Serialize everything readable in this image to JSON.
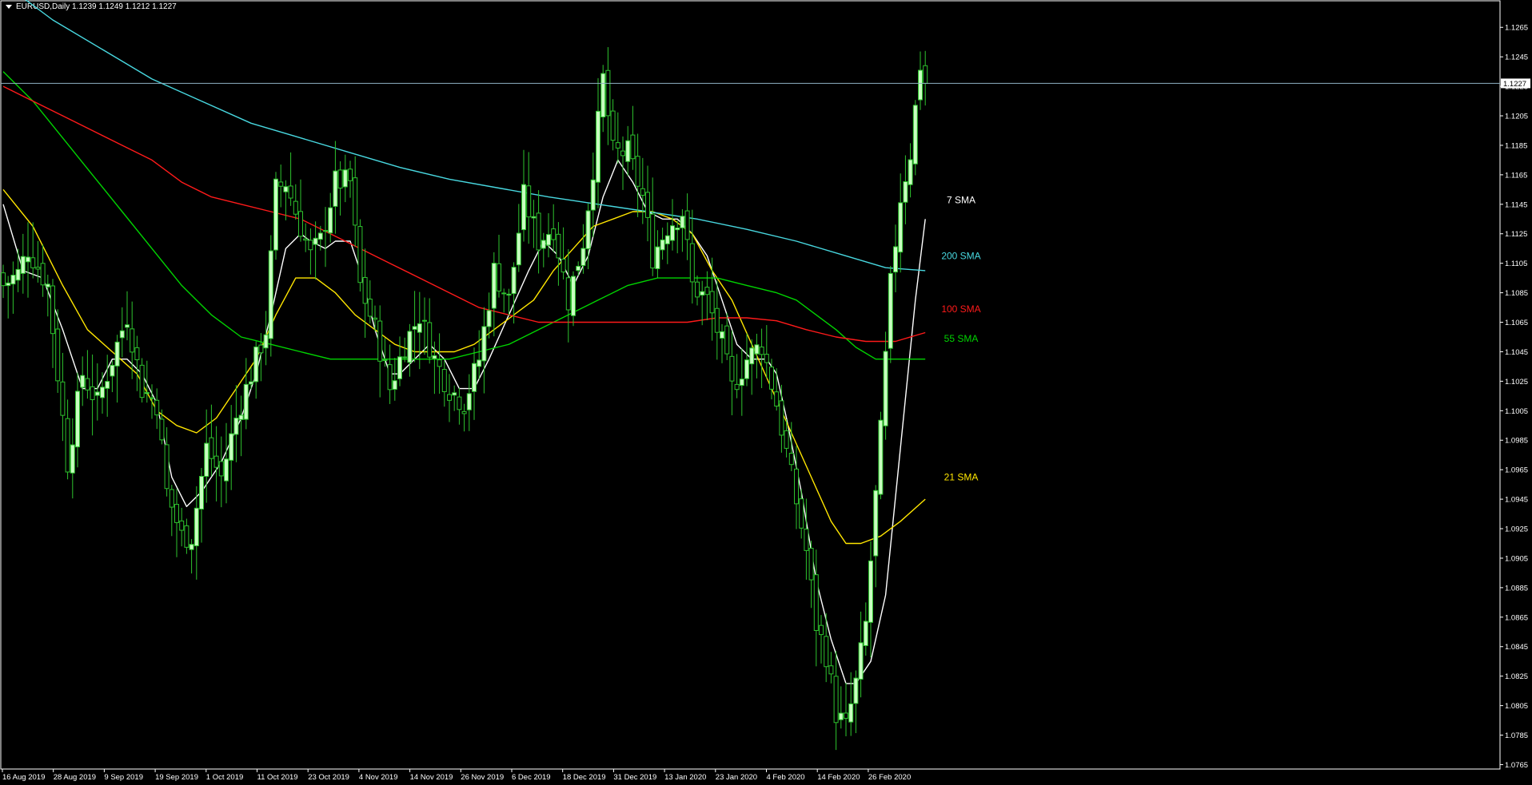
{
  "header": {
    "symbol_line": "EURUSD,Daily  1.1239 1.1249 1.1212 1.1227"
  },
  "colors": {
    "background": "#000000",
    "frame": "#ffffff",
    "candle_bull_body": "#c8ffc0",
    "candle_wick": "#2ec32e",
    "candle_bear_body": "#000000",
    "sma7": "#ffffff",
    "sma21": "#ffe600",
    "sma55": "#00d400",
    "sma100": "#ff1a1a",
    "sma200": "#48d8e0",
    "bid_line": "#8fb3c4",
    "axis_text": "#ffffff"
  },
  "chart_data": {
    "type": "candlestick",
    "symbol": "EURUSD",
    "timeframe": "Daily",
    "last_ohlc": {
      "open": 1.1239,
      "high": 1.1249,
      "low": 1.1212,
      "close": 1.1227
    },
    "current_price_label": "1.1227",
    "ylim": [
      1.0762,
      1.1283
    ],
    "y_ticks": [
      "1.1265",
      "1.1245",
      "1.1225",
      "1.1205",
      "1.1185",
      "1.1165",
      "1.1145",
      "1.1125",
      "1.1105",
      "1.1085",
      "1.1065",
      "1.1045",
      "1.1025",
      "1.1005",
      "1.0985",
      "1.0965",
      "1.0945",
      "1.0925",
      "1.0905",
      "1.0885",
      "1.0865",
      "1.0845",
      "1.0825",
      "1.0805",
      "1.0785",
      "1.0765"
    ],
    "x_ticks": [
      "16 Aug 2019",
      "28 Aug 2019",
      "9 Sep 2019",
      "19 Sep 2019",
      "1 Oct 2019",
      "11 Oct 2019",
      "23 Oct 2019",
      "4 Nov 2019",
      "14 Nov 2019",
      "26 Nov 2019",
      "6 Dec 2019",
      "18 Dec 2019",
      "31 Dec 2019",
      "13 Jan 2020",
      "23 Jan 2020",
      "4 Feb 2020",
      "14 Feb 2020",
      "26 Feb 2020"
    ],
    "grid": false,
    "candle_anchors": [
      {
        "d": 0,
        "c": 1.109
      },
      {
        "d": 3,
        "c": 1.1098
      },
      {
        "d": 5,
        "c": 1.1115
      },
      {
        "d": 9,
        "c": 1.109
      },
      {
        "d": 13,
        "c": 1.097
      },
      {
        "d": 16,
        "c": 1.103
      },
      {
        "d": 19,
        "c": 1.101
      },
      {
        "d": 22,
        "c": 1.104
      },
      {
        "d": 25,
        "c": 1.107
      },
      {
        "d": 28,
        "c": 1.102
      },
      {
        "d": 31,
        "c": 1.101
      },
      {
        "d": 33,
        "c": 1.095
      },
      {
        "d": 36,
        "c": 1.092
      },
      {
        "d": 38,
        "c": 1.092
      },
      {
        "d": 41,
        "c": 1.098
      },
      {
        "d": 44,
        "c": 1.096
      },
      {
        "d": 47,
        "c": 1.1
      },
      {
        "d": 50,
        "c": 1.103
      },
      {
        "d": 53,
        "c": 1.106
      },
      {
        "d": 55,
        "c": 1.1155
      },
      {
        "d": 57,
        "c": 1.116
      },
      {
        "d": 59,
        "c": 1.114
      },
      {
        "d": 62,
        "c": 1.111
      },
      {
        "d": 64,
        "c": 1.112
      },
      {
        "d": 67,
        "c": 1.116
      },
      {
        "d": 70,
        "c": 1.116
      },
      {
        "d": 72,
        "c": 1.109
      },
      {
        "d": 75,
        "c": 1.106
      },
      {
        "d": 78,
        "c": 1.102
      },
      {
        "d": 81,
        "c": 1.105
      },
      {
        "d": 84,
        "c": 1.107
      },
      {
        "d": 87,
        "c": 1.104
      },
      {
        "d": 90,
        "c": 1.102
      },
      {
        "d": 93,
        "c": 1.101
      },
      {
        "d": 96,
        "c": 1.104
      },
      {
        "d": 99,
        "c": 1.11
      },
      {
        "d": 102,
        "c": 1.108
      },
      {
        "d": 105,
        "c": 1.115
      },
      {
        "d": 108,
        "c": 1.112
      },
      {
        "d": 111,
        "c": 1.113
      },
      {
        "d": 114,
        "c": 1.108
      },
      {
        "d": 117,
        "c": 1.112
      },
      {
        "d": 119,
        "c": 1.117
      },
      {
        "d": 121,
        "c": 1.123
      },
      {
        "d": 123,
        "c": 1.118
      },
      {
        "d": 126,
        "c": 1.118
      },
      {
        "d": 129,
        "c": 1.115
      },
      {
        "d": 131,
        "c": 1.111
      },
      {
        "d": 134,
        "c": 1.113
      },
      {
        "d": 137,
        "c": 1.114
      },
      {
        "d": 139,
        "c": 1.109
      },
      {
        "d": 142,
        "c": 1.108
      },
      {
        "d": 145,
        "c": 1.105
      },
      {
        "d": 147,
        "c": 1.102
      },
      {
        "d": 150,
        "c": 1.104
      },
      {
        "d": 153,
        "c": 1.105
      },
      {
        "d": 156,
        "c": 1.101
      },
      {
        "d": 159,
        "c": 1.096
      },
      {
        "d": 162,
        "c": 1.091
      },
      {
        "d": 164,
        "c": 1.086
      },
      {
        "d": 166,
        "c": 1.084
      },
      {
        "d": 168,
        "c": 1.08
      },
      {
        "d": 170,
        "c": 1.079
      },
      {
        "d": 172,
        "c": 1.082
      },
      {
        "d": 174,
        "c": 1.086
      },
      {
        "d": 177,
        "c": 1.099
      },
      {
        "d": 179,
        "c": 1.109
      },
      {
        "d": 181,
        "c": 1.115
      },
      {
        "d": 183,
        "c": 1.118
      },
      {
        "d": 185,
        "c": 1.124
      },
      {
        "d": 186,
        "c": 1.1227
      }
    ],
    "series": [
      {
        "name": "7 SMA",
        "label_color": "#ffffff",
        "points": [
          [
            0,
            1.1145
          ],
          [
            4,
            1.11
          ],
          [
            8,
            1.1095
          ],
          [
            12,
            1.106
          ],
          [
            16,
            1.102
          ],
          [
            19,
            1.102
          ],
          [
            22,
            1.104
          ],
          [
            25,
            1.104
          ],
          [
            28,
            1.103
          ],
          [
            31,
            1.101
          ],
          [
            34,
            1.096
          ],
          [
            37,
            1.094
          ],
          [
            40,
            1.095
          ],
          [
            44,
            1.097
          ],
          [
            48,
            1.1
          ],
          [
            51,
            1.103
          ],
          [
            54,
            1.107
          ],
          [
            57,
            1.1115
          ],
          [
            60,
            1.1125
          ],
          [
            62,
            1.112
          ],
          [
            65,
            1.1115
          ],
          [
            67,
            1.112
          ],
          [
            70,
            1.112
          ],
          [
            72,
            1.11
          ],
          [
            75,
            1.106
          ],
          [
            78,
            1.103
          ],
          [
            80,
            1.103
          ],
          [
            83,
            1.104
          ],
          [
            86,
            1.105
          ],
          [
            89,
            1.104
          ],
          [
            92,
            1.102
          ],
          [
            95,
            1.102
          ],
          [
            98,
            1.104
          ],
          [
            102,
            1.107
          ],
          [
            106,
            1.11
          ],
          [
            109,
            1.112
          ],
          [
            112,
            1.111
          ],
          [
            115,
            1.109
          ],
          [
            118,
            1.111
          ],
          [
            121,
            1.115
          ],
          [
            124,
            1.1175
          ],
          [
            127,
            1.116
          ],
          [
            130,
            1.114
          ],
          [
            133,
            1.1135
          ],
          [
            136,
            1.1135
          ],
          [
            139,
            1.1125
          ],
          [
            142,
            1.111
          ],
          [
            145,
            1.108
          ],
          [
            148,
            1.105
          ],
          [
            151,
            1.104
          ],
          [
            154,
            1.104
          ],
          [
            156,
            1.103
          ],
          [
            158,
            1.1
          ],
          [
            161,
            1.095
          ],
          [
            164,
            1.089
          ],
          [
            167,
            1.085
          ],
          [
            170,
            1.082
          ],
          [
            172,
            1.082
          ],
          [
            175,
            1.0835
          ],
          [
            178,
            1.088
          ],
          [
            181,
            1.098
          ],
          [
            184,
            1.108
          ],
          [
            186,
            1.1135
          ]
        ]
      },
      {
        "name": "21 SMA",
        "label_color": "#ffe600",
        "points": [
          [
            0,
            1.1155
          ],
          [
            6,
            1.113
          ],
          [
            12,
            1.109
          ],
          [
            17,
            1.106
          ],
          [
            22,
            1.1045
          ],
          [
            27,
            1.103
          ],
          [
            31,
            1.1005
          ],
          [
            35,
            1.0995
          ],
          [
            39,
            1.099
          ],
          [
            43,
            1.1
          ],
          [
            47,
            1.102
          ],
          [
            51,
            1.104
          ],
          [
            55,
            1.107
          ],
          [
            59,
            1.1095
          ],
          [
            63,
            1.1095
          ],
          [
            67,
            1.1085
          ],
          [
            71,
            1.107
          ],
          [
            75,
            1.106
          ],
          [
            79,
            1.105
          ],
          [
            83,
            1.1045
          ],
          [
            87,
            1.1045
          ],
          [
            91,
            1.1045
          ],
          [
            95,
            1.105
          ],
          [
            99,
            1.106
          ],
          [
            103,
            1.107
          ],
          [
            107,
            1.108
          ],
          [
            111,
            1.11
          ],
          [
            115,
            1.1115
          ],
          [
            119,
            1.113
          ],
          [
            123,
            1.1135
          ],
          [
            127,
            1.114
          ],
          [
            131,
            1.114
          ],
          [
            135,
            1.1135
          ],
          [
            139,
            1.1125
          ],
          [
            143,
            1.11
          ],
          [
            147,
            1.108
          ],
          [
            151,
            1.105
          ],
          [
            155,
            1.102
          ],
          [
            159,
            1.099
          ],
          [
            163,
            1.096
          ],
          [
            167,
            1.093
          ],
          [
            170,
            1.0915
          ],
          [
            173,
            1.0915
          ],
          [
            177,
            1.092
          ],
          [
            181,
            1.093
          ],
          [
            186,
            1.0945
          ]
        ]
      },
      {
        "name": "55 SMA",
        "label_color": "#00d400",
        "points": [
          [
            0,
            1.1235
          ],
          [
            6,
            1.1215
          ],
          [
            12,
            1.119
          ],
          [
            18,
            1.1165
          ],
          [
            24,
            1.114
          ],
          [
            30,
            1.1115
          ],
          [
            36,
            1.109
          ],
          [
            42,
            1.107
          ],
          [
            48,
            1.1055
          ],
          [
            54,
            1.105
          ],
          [
            60,
            1.1045
          ],
          [
            66,
            1.104
          ],
          [
            72,
            1.104
          ],
          [
            78,
            1.104
          ],
          [
            84,
            1.104
          ],
          [
            90,
            1.104
          ],
          [
            96,
            1.1045
          ],
          [
            102,
            1.105
          ],
          [
            108,
            1.106
          ],
          [
            114,
            1.107
          ],
          [
            120,
            1.108
          ],
          [
            126,
            1.109
          ],
          [
            132,
            1.1095
          ],
          [
            138,
            1.1095
          ],
          [
            144,
            1.1095
          ],
          [
            150,
            1.109
          ],
          [
            156,
            1.1085
          ],
          [
            160,
            1.108
          ],
          [
            164,
            1.107
          ],
          [
            168,
            1.106
          ],
          [
            172,
            1.1048
          ],
          [
            176,
            1.104
          ],
          [
            181,
            1.104
          ],
          [
            186,
            1.104
          ]
        ]
      },
      {
        "name": "100 SMA",
        "label_color": "#ff1a1a",
        "points": [
          [
            0,
            1.1225
          ],
          [
            6,
            1.1215
          ],
          [
            12,
            1.1205
          ],
          [
            18,
            1.1195
          ],
          [
            24,
            1.1185
          ],
          [
            30,
            1.1175
          ],
          [
            36,
            1.116
          ],
          [
            42,
            1.115
          ],
          [
            48,
            1.1145
          ],
          [
            54,
            1.114
          ],
          [
            60,
            1.1135
          ],
          [
            66,
            1.1125
          ],
          [
            72,
            1.1115
          ],
          [
            78,
            1.1105
          ],
          [
            84,
            1.1095
          ],
          [
            90,
            1.1085
          ],
          [
            96,
            1.1075
          ],
          [
            102,
            1.107
          ],
          [
            108,
            1.1065
          ],
          [
            114,
            1.1065
          ],
          [
            120,
            1.1065
          ],
          [
            126,
            1.1065
          ],
          [
            132,
            1.1065
          ],
          [
            138,
            1.1065
          ],
          [
            144,
            1.1068
          ],
          [
            150,
            1.1068
          ],
          [
            156,
            1.1066
          ],
          [
            162,
            1.106
          ],
          [
            168,
            1.1055
          ],
          [
            174,
            1.1052
          ],
          [
            180,
            1.1052
          ],
          [
            186,
            1.1058
          ]
        ]
      },
      {
        "name": "200 SMA",
        "label_color": "#48d8e0",
        "points": [
          [
            0,
            1.1295
          ],
          [
            10,
            1.127
          ],
          [
            20,
            1.125
          ],
          [
            30,
            1.123
          ],
          [
            40,
            1.1215
          ],
          [
            50,
            1.12
          ],
          [
            60,
            1.119
          ],
          [
            70,
            1.118
          ],
          [
            80,
            1.117
          ],
          [
            90,
            1.1162
          ],
          [
            100,
            1.1156
          ],
          [
            110,
            1.115
          ],
          [
            120,
            1.1145
          ],
          [
            130,
            1.114
          ],
          [
            140,
            1.1135
          ],
          [
            150,
            1.1128
          ],
          [
            160,
            1.112
          ],
          [
            170,
            1.111
          ],
          [
            178,
            1.1102
          ],
          [
            186,
            1.11
          ]
        ]
      }
    ],
    "series_labels": [
      {
        "name": "7 SMA",
        "price": 1.1148
      },
      {
        "name": "200 SMA",
        "price": 1.111
      },
      {
        "name": "100 SMA",
        "price": 1.1074
      },
      {
        "name": "55 SMA",
        "price": 1.1054
      },
      {
        "name": "21 SMA",
        "price": 1.096
      }
    ]
  }
}
